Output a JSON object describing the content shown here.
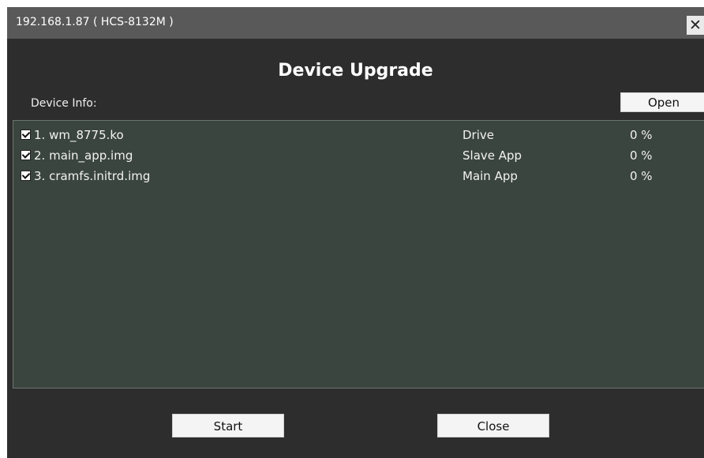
{
  "window": {
    "title": "192.168.1.87 ( HCS-8132M )",
    "close_glyph": "✕"
  },
  "main": {
    "heading": "Device Upgrade",
    "info_label": "Device Info:",
    "open_label": "Open"
  },
  "files": [
    {
      "checked": true,
      "name": "1. wm_8775.ko",
      "type": "Drive",
      "progress": "0 %"
    },
    {
      "checked": true,
      "name": "2. main_app.img",
      "type": "Slave App",
      "progress": "0 %"
    },
    {
      "checked": true,
      "name": "3. cramfs.initrd.img",
      "type": "Main App",
      "progress": "0 %"
    }
  ],
  "footer": {
    "start_label": "Start",
    "close_label": "Close"
  }
}
